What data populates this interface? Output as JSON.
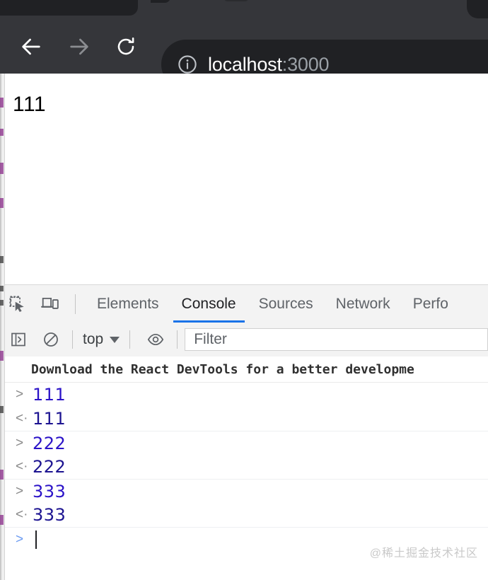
{
  "browser": {
    "nav": {
      "back_label": "Back",
      "forward_label": "Forward",
      "reload_label": "Reload"
    },
    "omnibox": {
      "security_icon": "info-circle-icon",
      "host": "localhost",
      "port": ":3000"
    }
  },
  "page": {
    "body_text": "111"
  },
  "devtools": {
    "toolbar_icons": [
      {
        "name": "inspect-element-icon",
        "label": "Inspect element"
      },
      {
        "name": "device-toolbar-icon",
        "label": "Toggle device toolbar"
      }
    ],
    "tabs": [
      {
        "label": "Elements",
        "active": false
      },
      {
        "label": "Console",
        "active": true
      },
      {
        "label": "Sources",
        "active": false
      },
      {
        "label": "Network",
        "active": false
      },
      {
        "label": "Perfo",
        "active": false
      }
    ],
    "accent_color": "#1a73e8",
    "filterbar": {
      "sidebar_icon": "show-console-sidebar-icon",
      "clear_icon": "clear-console-icon",
      "context_label": "top",
      "context_caret": "chevron-down-icon",
      "eye_icon": "live-expression-icon",
      "filter_placeholder": "Filter",
      "filter_value": ""
    },
    "console": {
      "banner": "Download the React DevTools for a better developme",
      "entries": [
        {
          "marker": ">",
          "type": "input",
          "value": "111",
          "separator": false
        },
        {
          "marker": "<·",
          "type": "result",
          "value": "111",
          "separator": false
        },
        {
          "marker": ">",
          "type": "input",
          "value": "222",
          "separator": true
        },
        {
          "marker": "<·",
          "type": "result",
          "value": "222",
          "separator": false
        },
        {
          "marker": ">",
          "type": "input",
          "value": "333",
          "separator": true
        },
        {
          "marker": "<·",
          "type": "result",
          "value": "333",
          "separator": false
        }
      ],
      "prompt": {
        "marker": ">",
        "value": ""
      }
    }
  },
  "watermark": "@稀土掘金技术社区"
}
